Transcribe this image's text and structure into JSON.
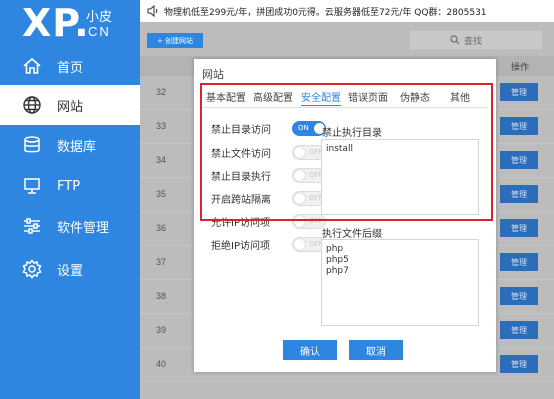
{
  "logo": {
    "main": "XP.",
    "sub_top": "小皮",
    "sub_bottom": "CN"
  },
  "sidebar": {
    "items": [
      {
        "label": "首页",
        "icon": "home-icon",
        "active": false
      },
      {
        "label": "网站",
        "icon": "globe-icon",
        "active": true
      },
      {
        "label": "数据库",
        "icon": "database-icon",
        "active": false
      },
      {
        "label": "FTP",
        "icon": "monitor-icon",
        "active": false
      },
      {
        "label": "软件管理",
        "icon": "sliders-icon",
        "active": false
      },
      {
        "label": "设置",
        "icon": "gear-icon",
        "active": false
      }
    ]
  },
  "topbar": {
    "notice": "物理机低至299元/年，拼团成功0元得。云服务器低至72元/年 QQ群：2805531"
  },
  "main": {
    "create_button": "+ 创建网站",
    "search_placeholder": "查找",
    "column_actions": "操作",
    "rows": [
      {
        "num": "32",
        "action": "管理"
      },
      {
        "num": "33",
        "action": "管理"
      },
      {
        "num": "34",
        "action": "管理"
      },
      {
        "num": "35",
        "action": "管理"
      },
      {
        "num": "36",
        "action": "管理"
      },
      {
        "num": "37",
        "action": "管理"
      },
      {
        "num": "38",
        "action": "管理"
      },
      {
        "num": "39",
        "action": "管理"
      },
      {
        "num": "40",
        "action": "管理"
      }
    ]
  },
  "modal": {
    "title": "网站",
    "tabs": [
      {
        "label": "基本配置",
        "active": false
      },
      {
        "label": "高级配置",
        "active": false
      },
      {
        "label": "安全配置",
        "active": true
      },
      {
        "label": "错误页面",
        "active": false
      },
      {
        "label": "伪静态",
        "active": false
      },
      {
        "label": "其他",
        "active": false
      }
    ],
    "options": [
      {
        "label": "禁止目录访问",
        "state": "ON",
        "on": true
      },
      {
        "label": "禁止文件访问",
        "state": "OFF",
        "on": false
      },
      {
        "label": "禁止目录执行",
        "state": "OFF",
        "on": false
      },
      {
        "label": "开启跨站隔离",
        "state": "OFF",
        "on": false
      },
      {
        "label": "允许IP访问项",
        "state": "OFF",
        "on": false
      },
      {
        "label": "拒绝IP访问项",
        "state": "OFF",
        "on": false
      }
    ],
    "exec_dir_label": "禁止执行目录",
    "exec_dir_value": "install",
    "ext_label": "执行文件后缀",
    "ext_values": [
      "php",
      "php5",
      "php7"
    ],
    "confirm_label": "确认",
    "cancel_label": "取消"
  },
  "colors": {
    "accent": "#2f86e0",
    "highlight": "#d9232d"
  }
}
